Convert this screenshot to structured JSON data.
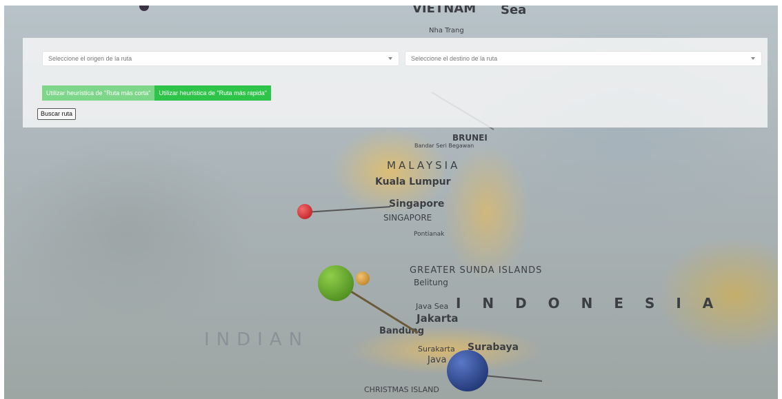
{
  "form": {
    "origin_placeholder": "Seleccione el origen de la ruta",
    "destination_placeholder": "Seleccione el destino de la ruta",
    "heuristic_short_label": "Utilizar heurística de \"Ruta más corta\"",
    "heuristic_fast_label": "Utilizar heurística de \"Ruta más rapida\"",
    "search_button_label": "Buscar ruta"
  },
  "map_labels": {
    "vietnam": "VIETNAM",
    "sea": "Sea",
    "nha_trang": "Nha Trang",
    "brunei": "BRUNEI",
    "bandar": "Bandar Seri Begawan",
    "malaysia": "MALAYSIA",
    "kuala_lumpur": "Kuala Lumpur",
    "singapore": "Singapore",
    "singapore_caps": "SINGAPORE",
    "pontianak": "Pontianak",
    "greater_sunda": "GREATER SUNDA ISLANDS",
    "belitung": "Belitung",
    "indonesia": "I N D O N E S I A",
    "java_sea": "Java Sea",
    "jakarta": "Jakarta",
    "bandung": "Bandung",
    "surakarta": "Surakarta",
    "surabaya": "Surabaya",
    "java": "Java",
    "indian": "INDIAN",
    "christmas": "CHRISTMAS ISLAND"
  },
  "colors": {
    "heuristic_short_bg": "#7dd689",
    "heuristic_fast_bg": "#2ec349",
    "panel_bg": "rgba(250,250,250,0.78)"
  }
}
